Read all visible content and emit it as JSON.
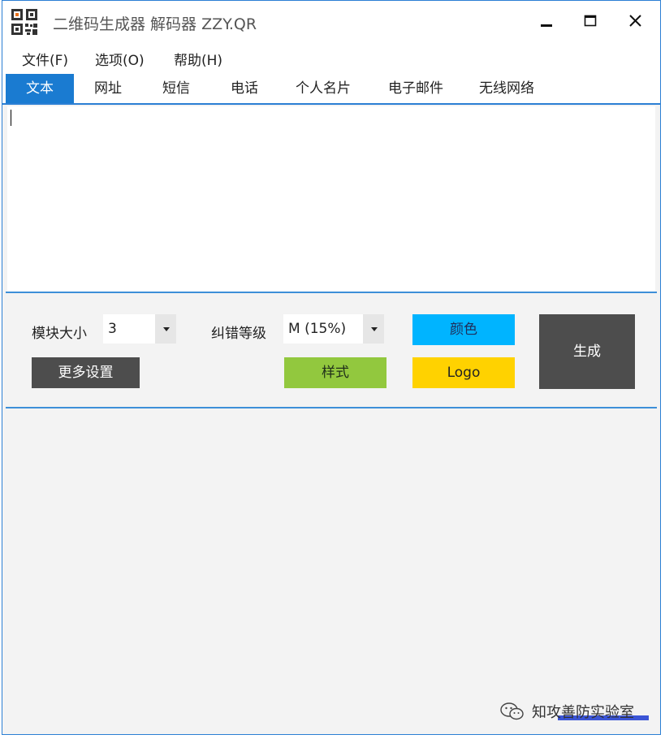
{
  "window": {
    "title": "二维码生成器 解码器 ZZY.QR"
  },
  "menu": {
    "file": "文件(F)",
    "options": "选项(O)",
    "help": "帮助(H)"
  },
  "tabs": [
    {
      "label": "文本",
      "active": true
    },
    {
      "label": "网址",
      "active": false
    },
    {
      "label": "短信",
      "active": false
    },
    {
      "label": "电话",
      "active": false
    },
    {
      "label": "个人名片",
      "active": false
    },
    {
      "label": "电子邮件",
      "active": false
    },
    {
      "label": "无线网络",
      "active": false
    }
  ],
  "content": {
    "text_value": ""
  },
  "settings": {
    "module_size_label": "模块大小",
    "module_size_value": "3",
    "error_level_label": "纠错等级",
    "error_level_value": "M (15%)",
    "color_button": "颜色",
    "generate_button": "生成",
    "more_settings_button": "更多设置",
    "style_button": "样式",
    "logo_button": "Logo"
  },
  "colors": {
    "accent": "#1a7bd1",
    "color_button_bg": "#00b4ff",
    "style_button_bg": "#92c83e",
    "logo_button_bg": "#ffd200",
    "dark_button_bg": "#4d4d4d"
  },
  "watermark": {
    "text": "知攻善防实验室"
  },
  "icons": {
    "app": "qr-code-icon",
    "minimize": "minimize-icon",
    "maximize": "maximize-icon",
    "close": "close-icon",
    "watermark": "wechat-icon"
  }
}
